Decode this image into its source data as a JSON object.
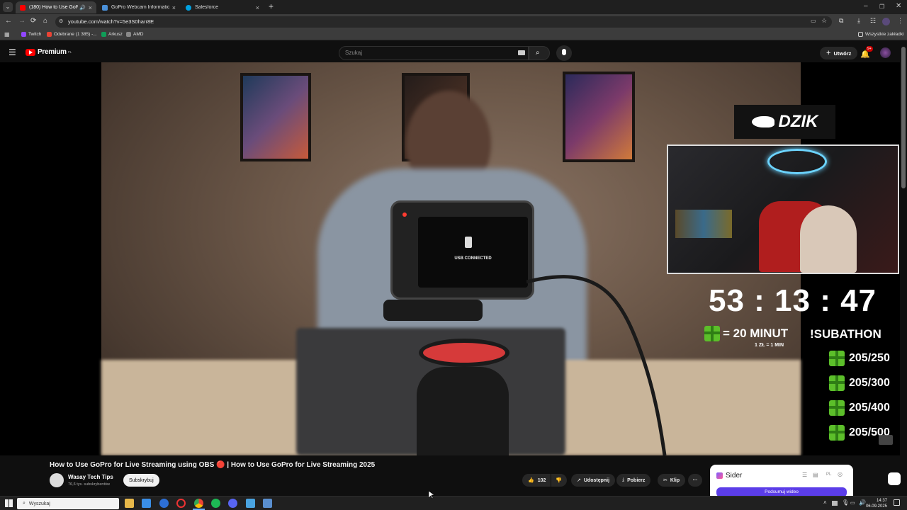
{
  "browser": {
    "tabs": [
      {
        "title": "(180) How to Use GoPro fo",
        "color": "#ff0000",
        "active": true
      },
      {
        "title": "GoPro Webcam Information Ar",
        "color": "#4a90d9",
        "active": false
      },
      {
        "title": "Salesforce",
        "color": "#00a1e0",
        "active": false
      }
    ],
    "new_tab": "+",
    "url": "youtube.com/watch?v=5e3S0harr8E",
    "bookmarks": [
      {
        "label": "Twitch",
        "color": "#9146ff"
      },
      {
        "label": "Odebrane (1 385) -...",
        "color": "#ea4335"
      },
      {
        "label": "Arkusz",
        "color": "#0f9d58"
      },
      {
        "label": "AMD",
        "color": "#888888"
      }
    ],
    "all_bookmarks": "Wszystkie zakładki"
  },
  "youtube": {
    "logo_text": "Premium",
    "logo_sup": "PL",
    "search_placeholder": "Szukaj",
    "create_label": "Utwórz",
    "notif_count": "9+"
  },
  "video": {
    "camera_screen_text": "USB CONNECTED",
    "brand_overlay": "DZIK",
    "timer": "53 : 13 : 47",
    "gift_rule": "= 20 MINUT",
    "gift_sub": "1 ZŁ = 1 MIN",
    "subathon": "!SUBATHON",
    "goals": [
      "205/250",
      "205/300",
      "205/400",
      "205/500"
    ]
  },
  "info": {
    "title": "How to Use GoPro for Live Streaming using OBS 🔴 | How to Use GoPro for Live Streaming 2025",
    "channel": "Wasay Tech Tips",
    "subscribers": "76,6 tys. subskrybentów",
    "subscribe": "Subskrybuj",
    "likes": "102",
    "share": "Udostępnij",
    "download": "Pobierz",
    "clip": "Klip",
    "more": "···"
  },
  "sider": {
    "name": "Sider",
    "button": "Podsumuj wideo"
  },
  "taskbar": {
    "search": "Wyszukaj",
    "time": "14:37",
    "date": "06.09.2025"
  }
}
